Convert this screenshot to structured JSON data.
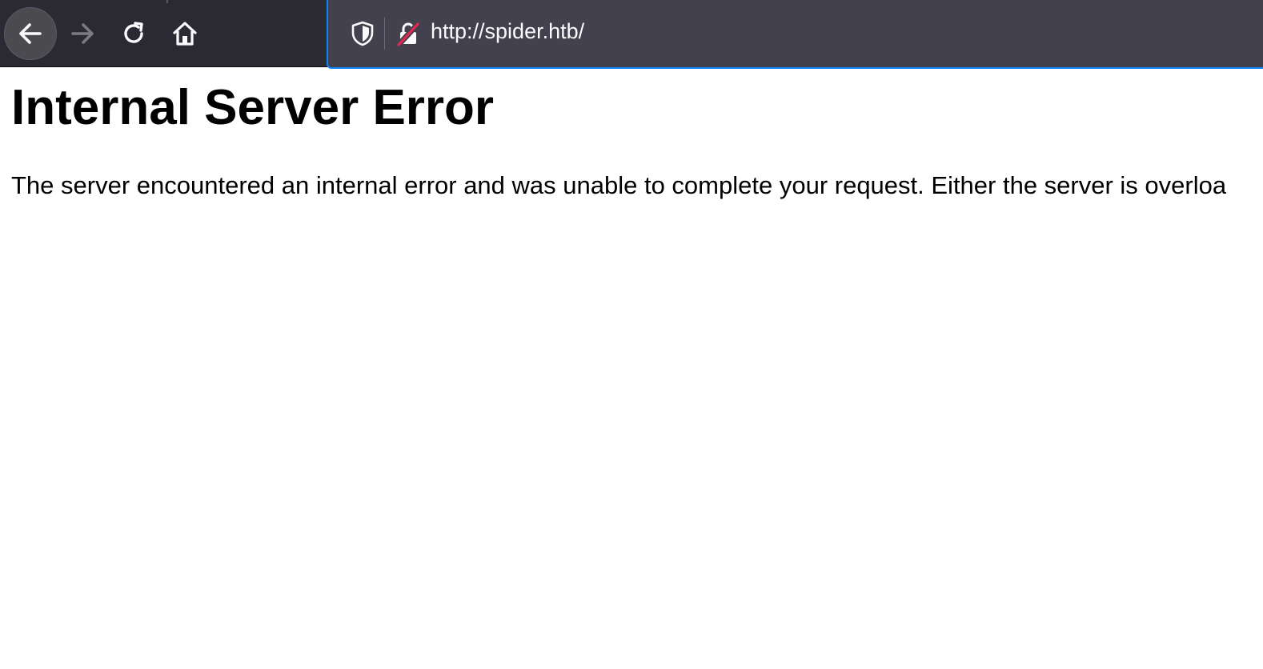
{
  "browser": {
    "url": "http://spider.htb/",
    "icons": {
      "back": "arrow-left-icon",
      "forward": "arrow-right-icon",
      "reload": "reload-icon",
      "home": "home-icon",
      "tracking": "shield-icon",
      "security": "insecure-lock-icon"
    },
    "colors": {
      "toolbar": "#2b2a33",
      "urlbar": "#42414d",
      "focus_ring": "#0a84ff",
      "insecure_strike": "#e22850"
    }
  },
  "page": {
    "heading": "Internal Server Error",
    "message": "The server encountered an internal error and was unable to complete your request. Either the server is overloa"
  }
}
